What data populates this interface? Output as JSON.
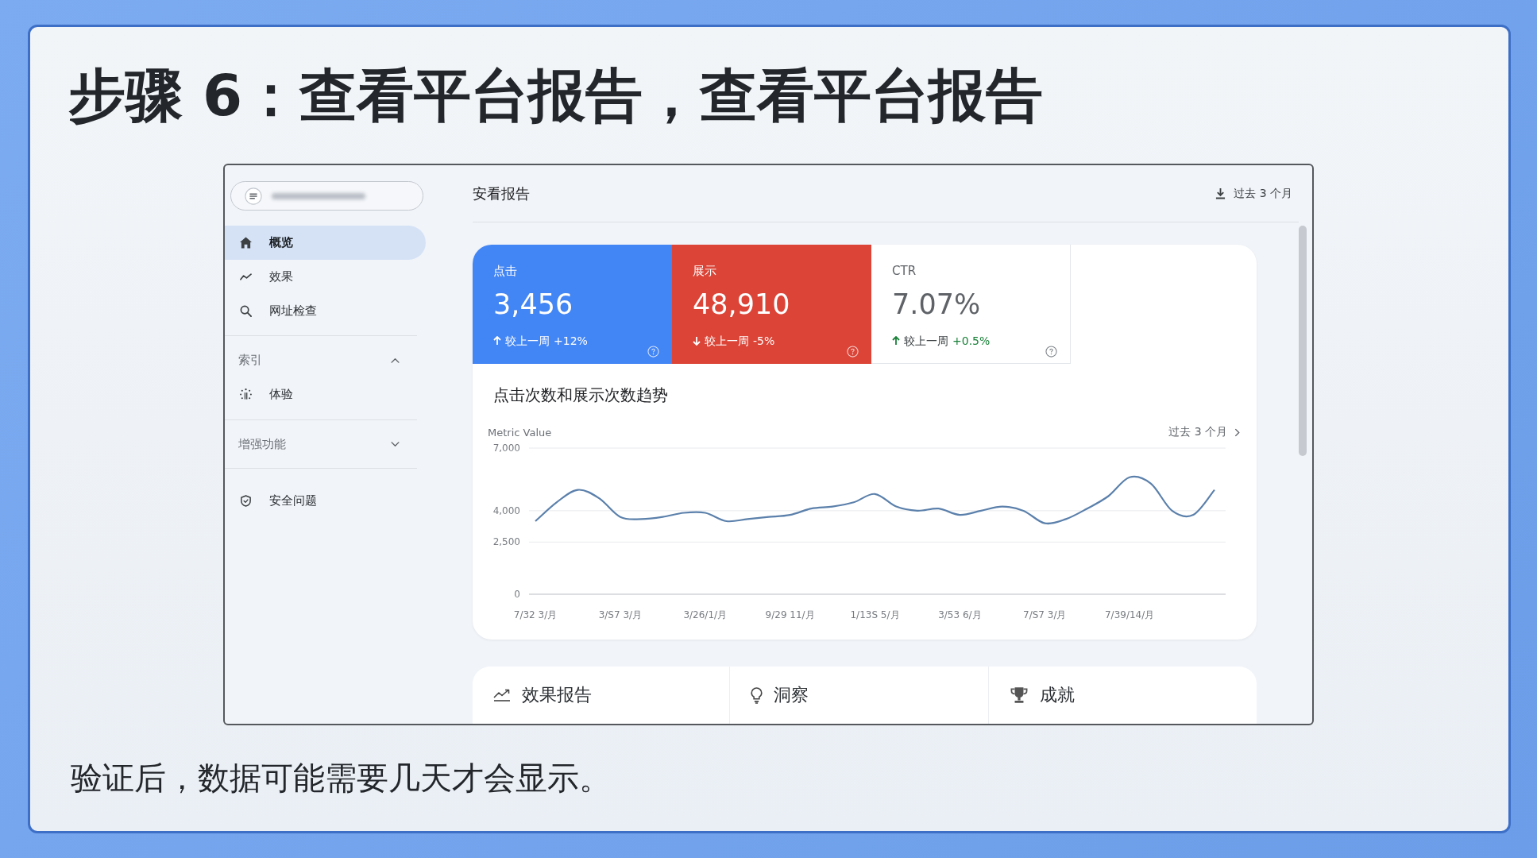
{
  "title": "步骤 6：查看平台报告，查看平台报告",
  "screenshot": {
    "sidebar": {
      "items": [
        {
          "label": "概览",
          "selected": true
        },
        {
          "label": "效果",
          "selected": false
        },
        {
          "label": "网址检查",
          "selected": false
        }
      ],
      "sections": [
        {
          "title": "索引",
          "expanded": true,
          "items": [
            {
              "label": "体验",
              "selected": false
            }
          ]
        },
        {
          "title": "增强功能",
          "expanded": false
        }
      ],
      "footer_items": [
        {
          "label": "安全问题",
          "selected": false
        }
      ]
    },
    "header": {
      "title": "安看报告",
      "date_range": "过去 3 个月"
    },
    "stats": [
      {
        "kind": "filled",
        "color": "#4285f4",
        "label": "点击",
        "value": "3,456",
        "rising": true,
        "comparison": "较上一周",
        "change": "+12%"
      },
      {
        "kind": "filled",
        "color": "#db4437",
        "label": "展示",
        "value": "48,910",
        "rising": false,
        "comparison": "较上一周",
        "change": "-5%"
      },
      {
        "kind": "plain",
        "color": "#ffffff",
        "label": "CTR",
        "value": "7.07%",
        "rising": true,
        "comparison": "较上一周",
        "change": "+0.5%"
      }
    ],
    "chart": {
      "title": "点击次数和展示次数趋势",
      "range_link": "过去 3 个月",
      "chart_data": {
        "type": "line",
        "ylabel": "Metric Value",
        "categories": [
          "7/32 3/月",
          null,
          null,
          null,
          "3/S7 3/月",
          null,
          null,
          null,
          "3/26/1/月",
          null,
          null,
          null,
          "9/29 11/月",
          null,
          null,
          null,
          "1/13S 5/月",
          null,
          null,
          null,
          "3/53 6/月",
          null,
          null,
          null,
          "7/S7 3/月",
          null,
          null,
          null,
          "7/39/14/月",
          null,
          null,
          null,
          null
        ],
        "series": [
          {
            "color": "#5b80ab",
            "values": [
              3500,
              4400,
              5000,
              4600,
              3700,
              3600,
              3700,
              3900,
              3900,
              3500,
              3600,
              3700,
              3800,
              4100,
              4200,
              4400,
              4800,
              4200,
              4000,
              4100,
              3800,
              4000,
              4200,
              4000,
              3400,
              3600,
              4100,
              4700,
              5600,
              5300,
              4000,
              3800,
              5000
            ]
          }
        ],
        "ylim": [
          0,
          7000
        ],
        "yticks": [
          {
            "value": 0,
            "label": "0"
          },
          {
            "value": 2500,
            "label": "2,500"
          },
          {
            "value": 4000,
            "label": "4,000"
          },
          {
            "value": 7000,
            "label": "7,000"
          }
        ]
      }
    },
    "feature_cards": [
      {
        "title": "效果报告"
      },
      {
        "title": "洞察"
      },
      {
        "title": "成就"
      }
    ]
  },
  "caption": "验证后，数据可能需要几天才会显示。"
}
